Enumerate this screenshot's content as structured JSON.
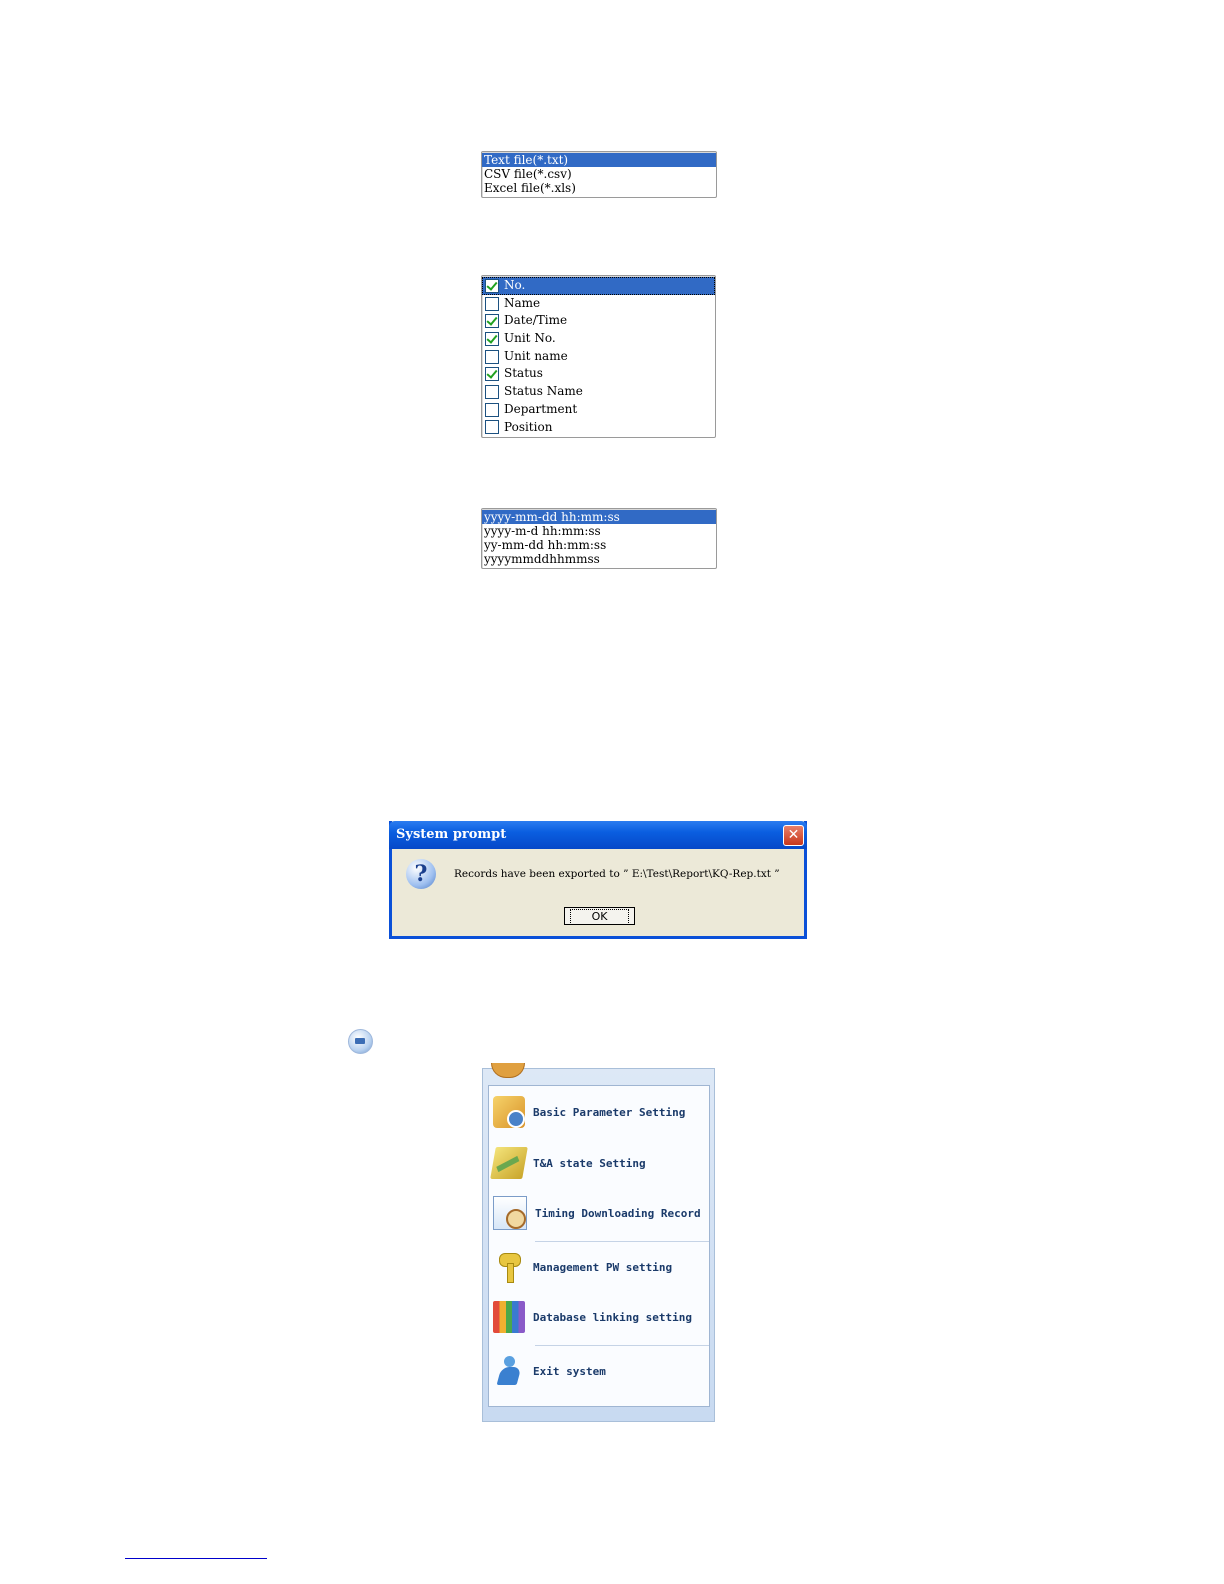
{
  "file_type_list": {
    "items": [
      {
        "label": "Text file(*.txt)",
        "selected": true
      },
      {
        "label": "CSV file(*.csv)",
        "selected": false
      },
      {
        "label": "Excel file(*.xls)",
        "selected": false
      }
    ]
  },
  "fields_list": {
    "items": [
      {
        "label": "No.",
        "checked": true,
        "selected": true
      },
      {
        "label": "Name",
        "checked": false,
        "selected": false
      },
      {
        "label": "Date/Time",
        "checked": true,
        "selected": false
      },
      {
        "label": "Unit No.",
        "checked": true,
        "selected": false
      },
      {
        "label": "Unit name",
        "checked": false,
        "selected": false
      },
      {
        "label": "Status",
        "checked": true,
        "selected": false
      },
      {
        "label": "Status Name",
        "checked": false,
        "selected": false
      },
      {
        "label": "Department",
        "checked": false,
        "selected": false
      },
      {
        "label": "Position",
        "checked": false,
        "selected": false
      }
    ]
  },
  "date_format_list": {
    "items": [
      {
        "label": "yyyy-mm-dd hh:mm:ss",
        "selected": true
      },
      {
        "label": "yyyy-m-d hh:mm:ss",
        "selected": false
      },
      {
        "label": "yy-mm-dd hh:mm:ss",
        "selected": false
      },
      {
        "label": "yyyymmddhhmmss",
        "selected": false
      }
    ]
  },
  "dialog": {
    "title": "System prompt",
    "close_glyph": "✕",
    "icon": "question-icon",
    "message": "Records have been exported to ” E:\\Test\\Report\\KQ-Rep.txt ”",
    "ok_label": "OK"
  },
  "menu": {
    "items": [
      {
        "label": "Basic Parameter Setting",
        "icon": "parameter-icon"
      },
      {
        "label": "T&A state Setting",
        "icon": "ta-state-icon"
      },
      {
        "label": "Timing Downloading Record",
        "icon": "timing-icon"
      },
      {
        "label": "Management PW setting",
        "icon": "key-icon"
      },
      {
        "label": "Database linking setting",
        "icon": "database-icon"
      },
      {
        "label": "Exit system",
        "icon": "exit-icon"
      }
    ]
  },
  "colors": {
    "selection": "#316ac5",
    "dialog_title": "#0a5ee0",
    "dialog_face": "#ece9d8",
    "menu_text": "#1a3a6a"
  }
}
